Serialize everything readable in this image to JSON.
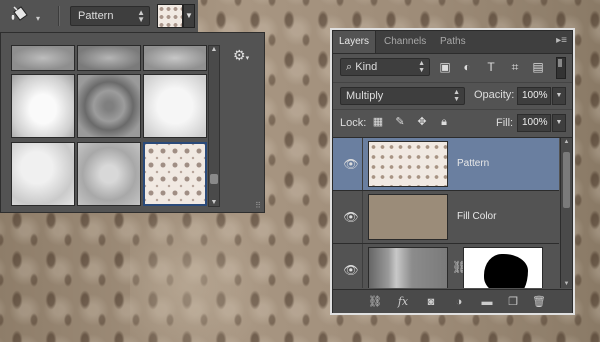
{
  "options_bar": {
    "tool_icon": "paint-bucket-icon",
    "fill_source": "Pattern",
    "pattern_swatch": "damask-pattern"
  },
  "pattern_picker": {
    "patterns": [
      "soft-gray-1",
      "soft-gray-2",
      "soft-gray-3",
      "white-clouds",
      "gray-damask",
      "white-soft",
      "white-texture",
      "gray-texture",
      "damask-selected"
    ],
    "selected_index": 8,
    "gear_icon": "gear-icon"
  },
  "layers_panel": {
    "tabs": [
      {
        "label": "Layers",
        "active": true
      },
      {
        "label": "Channels",
        "active": false
      },
      {
        "label": "Paths",
        "active": false
      }
    ],
    "filter_kind": "Kind",
    "blend_mode": "Multiply",
    "opacity_label": "Opacity:",
    "opacity": "100%",
    "lock_label": "Lock:",
    "fill_label": "Fill:",
    "fill": "100%",
    "layers": [
      {
        "name": "Pattern",
        "selected": true,
        "visible": true
      },
      {
        "name": "Fill Color",
        "selected": false,
        "visible": true
      },
      {
        "name": "",
        "selected": false,
        "visible": true
      }
    ]
  },
  "colors": {
    "panel_bg": "#535353",
    "selected_layer": "#6a7fa0",
    "fill_color_swatch": "#9b8c79"
  }
}
